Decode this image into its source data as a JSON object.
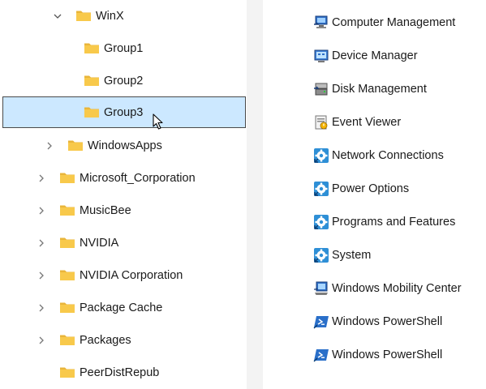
{
  "tree": {
    "items": [
      {
        "label": "WinX",
        "expanded": true
      },
      {
        "label": "Group1"
      },
      {
        "label": "Group2"
      },
      {
        "label": "Group3",
        "selected": true
      },
      {
        "label": "WindowsApps",
        "expanded": false
      },
      {
        "label": "Microsoft_Corporation",
        "expanded": false
      },
      {
        "label": "MusicBee",
        "expanded": false
      },
      {
        "label": "NVIDIA",
        "expanded": false
      },
      {
        "label": "NVIDIA Corporation",
        "expanded": false
      },
      {
        "label": "Package Cache",
        "expanded": false
      },
      {
        "label": "Packages",
        "expanded": false
      },
      {
        "label": "PeerDistRepub"
      }
    ]
  },
  "list": {
    "items": [
      {
        "label": "Computer Management",
        "icon": "computer-management-icon"
      },
      {
        "label": "Device Manager",
        "icon": "device-manager-icon"
      },
      {
        "label": "Disk Management",
        "icon": "disk-management-icon"
      },
      {
        "label": "Event Viewer",
        "icon": "event-viewer-icon"
      },
      {
        "label": "Network Connections",
        "icon": "gear-shortcut-icon"
      },
      {
        "label": "Power Options",
        "icon": "gear-shortcut-icon"
      },
      {
        "label": "Programs and Features",
        "icon": "gear-shortcut-icon"
      },
      {
        "label": "System",
        "icon": "gear-shortcut-icon"
      },
      {
        "label": "Windows Mobility Center",
        "icon": "mobility-center-icon"
      },
      {
        "label": "Windows PowerShell",
        "icon": "powershell-icon"
      },
      {
        "label": "Windows PowerShell",
        "icon": "powershell-icon"
      }
    ]
  },
  "colors": {
    "selection_bg": "#cce8ff",
    "folder": "#f8c94b",
    "divider": "#f3f3f3"
  }
}
